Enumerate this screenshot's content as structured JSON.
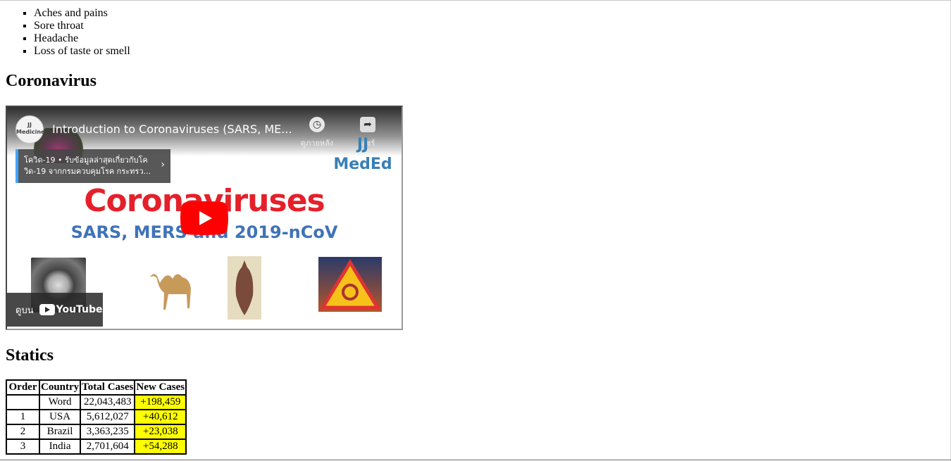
{
  "symptoms": [
    "Aches and pains",
    "Sore throat",
    "Headache",
    "Loss of taste or smell"
  ],
  "sections": {
    "video_heading": "Coronavirus",
    "stats_heading": "Statics"
  },
  "video": {
    "channel_avatar_text": "JJ Medicine",
    "title": "Introduction to Coronaviruses (SARS, ME...",
    "watch_later_label": "ดูภายหลัง",
    "share_label": "แชร์",
    "logo_line1": "JJ",
    "logo_line2": "MedEd",
    "info_card_text": "โควิด-19 • รับข้อมูลล่าสุดเกี่ยวกับโควิด-19 จากกรมควบคุมโรค กระทรว...",
    "thumbnail_title": "Coronaviruses",
    "thumbnail_subtitle": "SARS, MERS and 2019-nCoV",
    "watch_on_label": "ดูบน",
    "youtube_label": "YouTube",
    "colors": {
      "title_red": "#e5202a",
      "subtitle_blue": "#3f73b8",
      "play_red": "#ff0000"
    }
  },
  "table": {
    "headers": [
      "Order",
      "Country",
      "Total Cases",
      "New Cases"
    ],
    "rows": [
      [
        "",
        "Word",
        "22,043,483",
        "+198,459"
      ],
      [
        "1",
        "USA",
        "5,612,027",
        "+40,612"
      ],
      [
        "2",
        "Brazil",
        "3,363,235",
        "+23,038"
      ],
      [
        "3",
        "India",
        "2,701,604",
        "+54,288"
      ]
    ],
    "highlight_color": "#ffff00"
  }
}
